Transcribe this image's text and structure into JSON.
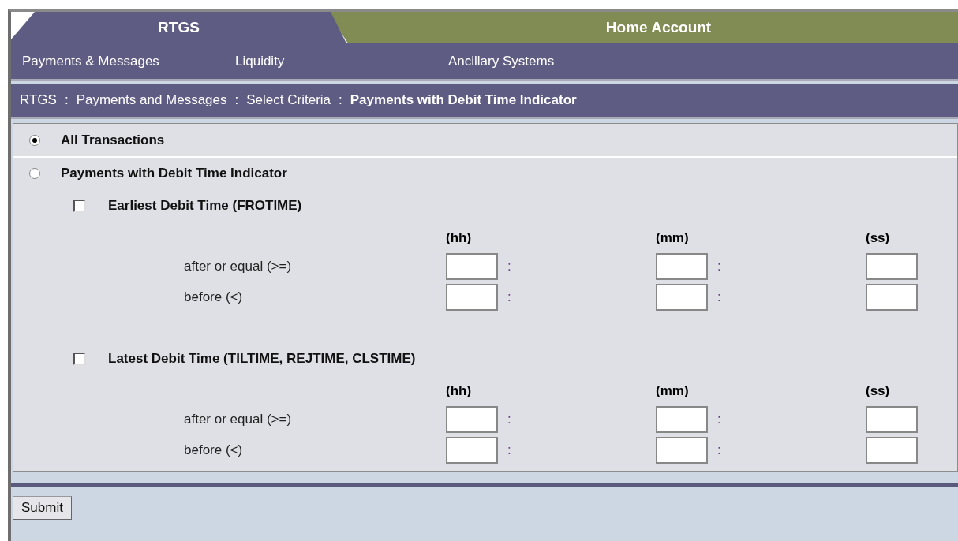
{
  "tabs": [
    {
      "label": "RTGS",
      "selected": true
    },
    {
      "label": "Home Account",
      "selected": false
    }
  ],
  "menu": [
    "Payments & Messages",
    "Liquidity",
    "Ancillary Systems"
  ],
  "breadcrumb": [
    {
      "text": "RTGS",
      "kind": "link"
    },
    {
      "text": ":",
      "kind": "sep"
    },
    {
      "text": "Payments and Messages",
      "kind": "link"
    },
    {
      "text": ":",
      "kind": "sep"
    },
    {
      "text": "Select Criteria",
      "kind": "link"
    },
    {
      "text": ":",
      "kind": "sep"
    },
    {
      "text": "Payments with Debit Time Indicator",
      "kind": "current"
    }
  ],
  "options": [
    {
      "label": "All Transactions",
      "selected": true
    },
    {
      "label": "Payments with Debit Time Indicator",
      "selected": false
    }
  ],
  "groups": [
    {
      "label": "Earliest Debit Time (FROTIME)",
      "checked": false,
      "headers": [
        "(hh)",
        "(mm)",
        "(ss)"
      ],
      "rows": [
        {
          "label": "after or equal (>=)",
          "separators": [
            ":",
            ":"
          ]
        },
        {
          "label": "before (<)",
          "separators": [
            ":",
            ":"
          ]
        }
      ]
    },
    {
      "label": "Latest Debit Time (TILTIME, REJTIME, CLSTIME)",
      "checked": false,
      "headers": [
        "(hh)",
        "(mm)",
        "(ss)"
      ],
      "rows": [
        {
          "label": "after or equal (>=)",
          "separators": [
            ":",
            ":"
          ]
        },
        {
          "label": "before (<)",
          "separators": [
            ":",
            ":"
          ]
        }
      ]
    }
  ],
  "submit": "Submit"
}
